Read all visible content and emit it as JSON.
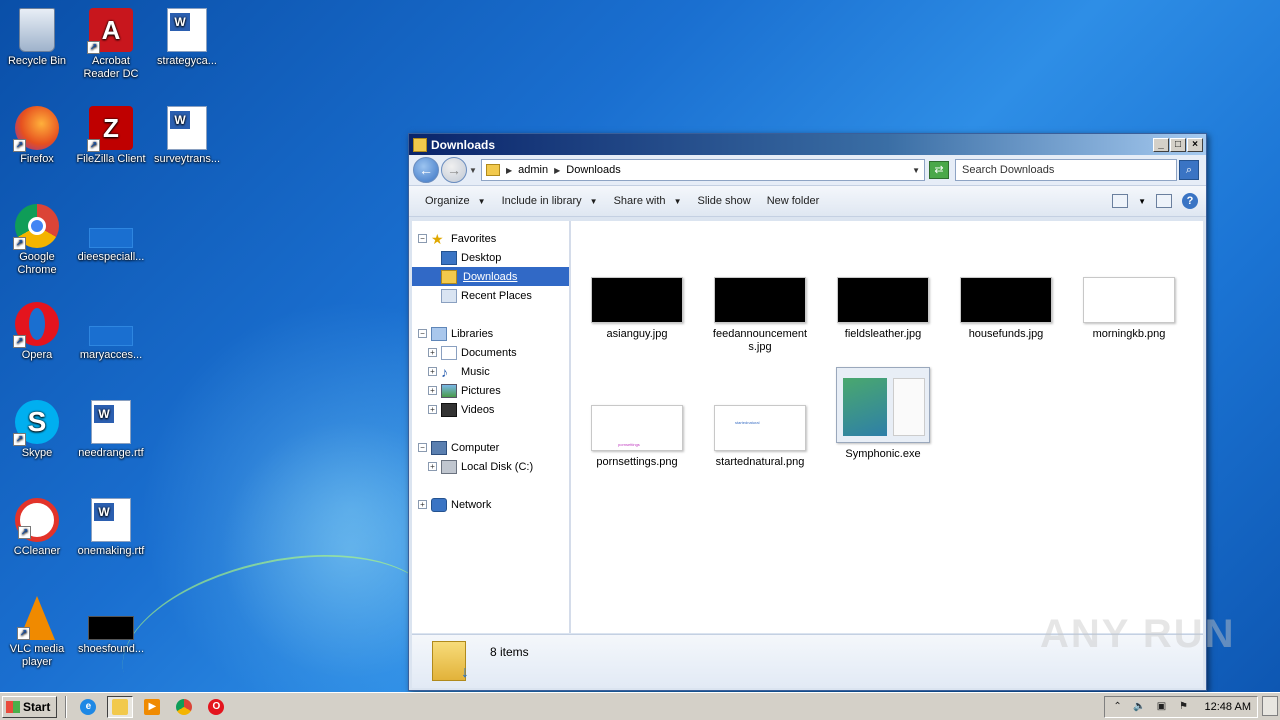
{
  "desktop": {
    "icons": [
      {
        "label": "Recycle Bin",
        "icon": "recycle-bin-icon"
      },
      {
        "label": "Acrobat Reader DC",
        "icon": "acrobat-reader-icon"
      },
      {
        "label": "strategyca...",
        "icon": "word-document-icon"
      },
      {
        "label": "Firefox",
        "icon": "firefox-icon"
      },
      {
        "label": "FileZilla Client",
        "icon": "filezilla-icon"
      },
      {
        "label": "surveytrans...",
        "icon": "word-document-icon"
      },
      {
        "label": "Google Chrome",
        "icon": "chrome-icon"
      },
      {
        "label": "dieespeciall...",
        "icon": "blank-file-icon"
      },
      {
        "label": "Opera",
        "icon": "opera-icon"
      },
      {
        "label": "maryacces...",
        "icon": "blank-file-icon"
      },
      {
        "label": "Skype",
        "icon": "skype-icon"
      },
      {
        "label": "needrange.rtf",
        "icon": "word-document-icon"
      },
      {
        "label": "CCleaner",
        "icon": "ccleaner-icon"
      },
      {
        "label": "onemaking.rtf",
        "icon": "word-document-icon"
      },
      {
        "label": "VLC media player",
        "icon": "vlc-icon"
      },
      {
        "label": "shoesfound...",
        "icon": "image-file-icon"
      }
    ]
  },
  "window": {
    "title": "Downloads",
    "buttons": {
      "minimize": "_",
      "maximize": "□",
      "close": "×"
    },
    "address": {
      "segments": [
        "admin",
        "Downloads"
      ]
    },
    "search": {
      "placeholder": "Search Downloads"
    },
    "toolbar": {
      "organize": "Organize",
      "include_in_library": "Include in library",
      "share_with": "Share with",
      "slide_show": "Slide show",
      "new_folder": "New folder"
    },
    "nav": {
      "favorites": "Favorites",
      "desktop": "Desktop",
      "downloads": "Downloads",
      "recent_places": "Recent Places",
      "libraries": "Libraries",
      "documents": "Documents",
      "music": "Music",
      "pictures": "Pictures",
      "videos": "Videos",
      "computer": "Computer",
      "local_disk": "Local Disk (C:)",
      "network": "Network"
    },
    "files": [
      {
        "name": "asianguy.jpg",
        "thumb": "black",
        "tiny": ""
      },
      {
        "name": "feedannouncements.jpg",
        "thumb": "black",
        "tiny": ""
      },
      {
        "name": "fieldsleather.jpg",
        "thumb": "black",
        "tiny": ""
      },
      {
        "name": "housefunds.jpg",
        "thumb": "black",
        "tiny": ""
      },
      {
        "name": "morningkb.png",
        "thumb": "white",
        "tiny": ""
      },
      {
        "name": "pornsettings.png",
        "thumb": "white",
        "tiny": "pornsettings"
      },
      {
        "name": "startednatural.png",
        "thumb": "white",
        "tiny": "startednatural"
      },
      {
        "name": "Symphonic.exe",
        "thumb": "exe",
        "tiny": ""
      }
    ],
    "status": {
      "count": "8 items"
    }
  },
  "taskbar": {
    "start": "Start",
    "apps": [
      "internet-explorer-icon",
      "file-explorer-icon",
      "media-player-icon",
      "chrome-icon",
      "opera-icon"
    ],
    "clock": "12:48 AM"
  },
  "watermark": "ANY RUN",
  "colors": {
    "selection": "#3169c6",
    "titlebar": "#0a246a"
  }
}
